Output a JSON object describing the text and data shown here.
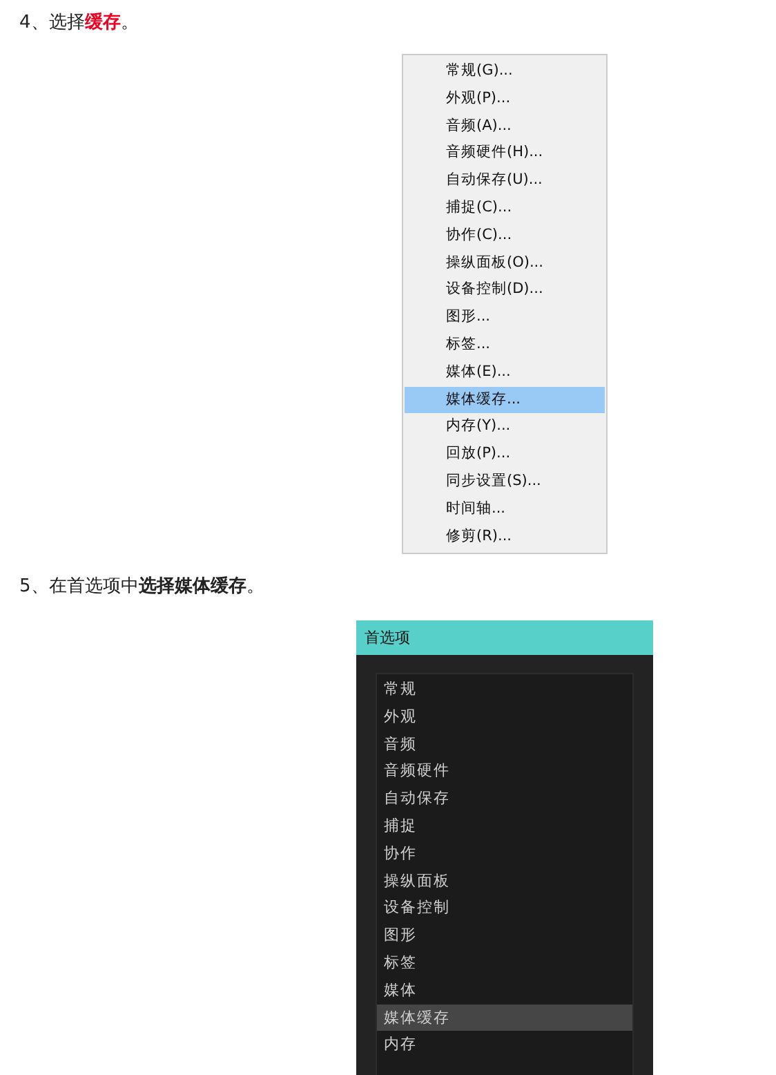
{
  "step_4": {
    "parts": [
      {
        "text": "4、选择",
        "emphasis": false
      },
      {
        "text": "缓存",
        "emphasis": true
      },
      {
        "text": "。",
        "emphasis": false
      }
    ]
  },
  "context_menu": {
    "items": [
      {
        "label": "常规(G)...",
        "selected": false
      },
      {
        "label": "外观(P)...",
        "selected": false
      },
      {
        "label": "音频(A)...",
        "selected": false
      },
      {
        "label": "音频硬件(H)...",
        "selected": false
      },
      {
        "label": "自动保存(U)...",
        "selected": false
      },
      {
        "label": "捕捉(C)...",
        "selected": false
      },
      {
        "label": "协作(C)...",
        "selected": false
      },
      {
        "label": "操纵面板(O)...",
        "selected": false
      },
      {
        "label": "设备控制(D)...",
        "selected": false
      },
      {
        "label": "图形...",
        "selected": false
      },
      {
        "label": "标签...",
        "selected": false
      },
      {
        "label": "媒体(E)...",
        "selected": false
      },
      {
        "label": "媒体缓存...",
        "selected": true
      },
      {
        "label": "内存(Y)...",
        "selected": false
      },
      {
        "label": "回放(P)...",
        "selected": false
      },
      {
        "label": "同步设置(S)...",
        "selected": false
      },
      {
        "label": "时间轴...",
        "selected": false
      },
      {
        "label": "修剪(R)...",
        "selected": false
      }
    ]
  },
  "step_5": {
    "text": "5、在首选项中**选择媒体缓存**。"
  },
  "preferences_dialog": {
    "title": "首选项",
    "items": [
      {
        "label": "常规",
        "selected": false
      },
      {
        "label": "外观",
        "selected": false
      },
      {
        "label": "音频",
        "selected": false
      },
      {
        "label": "音频硬件",
        "selected": false
      },
      {
        "label": "自动保存",
        "selected": false
      },
      {
        "label": "捕捉",
        "selected": false
      },
      {
        "label": "协作",
        "selected": false
      },
      {
        "label": "操纵面板",
        "selected": false
      },
      {
        "label": "设备控制",
        "selected": false
      },
      {
        "label": "图形",
        "selected": false
      },
      {
        "label": "标签",
        "selected": false
      },
      {
        "label": "媒体",
        "selected": false
      },
      {
        "label": "媒体缓存",
        "selected": true
      },
      {
        "label": "内存",
        "selected": false
      }
    ]
  }
}
